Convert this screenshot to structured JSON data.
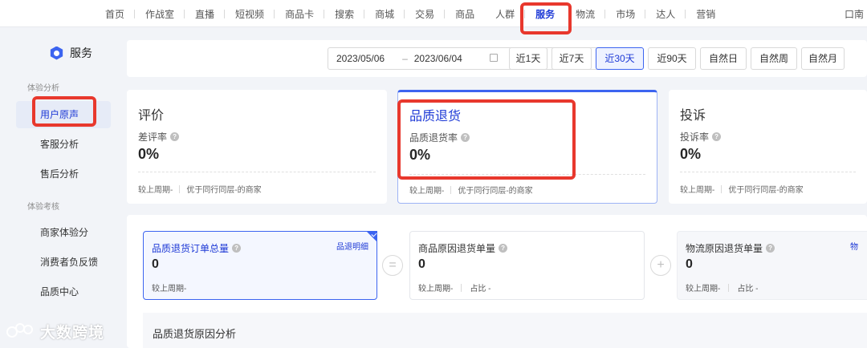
{
  "topnav": {
    "items": [
      "首页",
      "作战室",
      "直播",
      "短视频",
      "商品卡",
      "搜索",
      "商城",
      "交易",
      "商品",
      "人群",
      "服务",
      "物流",
      "市场",
      "达人",
      "营销"
    ],
    "active": "服务",
    "right_text": "口南"
  },
  "sidebar": {
    "title": "服务",
    "groups": [
      {
        "label": "体验分析",
        "items": [
          "用户原声",
          "客服分析",
          "售后分析"
        ]
      },
      {
        "label": "体验考核",
        "items": [
          "商家体验分",
          "消费者负反馈",
          "品质中心"
        ]
      }
    ],
    "active_item": "用户原声"
  },
  "datebar": {
    "start_date": "2023/05/06",
    "separator": "–",
    "end_date": "2023/06/04",
    "ranges": [
      "近1天",
      "近7天",
      "近30天",
      "近90天",
      "自然日",
      "自然周",
      "自然月"
    ],
    "active_range": "近30天"
  },
  "cards": [
    {
      "title": "评价",
      "metric": "差评率",
      "value": "0%",
      "prev": "较上周期-",
      "peer": "优于同行同层-的商家"
    },
    {
      "title": "品质退货",
      "metric": "品质退货率",
      "value": "0%",
      "prev": "较上周期-",
      "peer": "优于同行同层-的商家"
    },
    {
      "title": "投诉",
      "metric": "投诉率",
      "value": "0%",
      "prev": "较上周期-",
      "peer": "优于同行同层-的商家"
    }
  ],
  "subcards": [
    {
      "title": "品质退货订单总量",
      "value": "0",
      "prev": "较上周期-",
      "share": "",
      "link": "品退明细"
    },
    {
      "title": "商品原因退货单量",
      "value": "0",
      "prev": "较上周期-",
      "share": "占比 -",
      "link": ""
    },
    {
      "title": "物流原因退货单量",
      "value": "0",
      "prev": "较上周期-",
      "share": "占比 -",
      "link": "物"
    }
  ],
  "operators": [
    "=",
    "+"
  ],
  "analysis_title": "品质退货原因分析",
  "watermark": "大数跨境",
  "colors": {
    "accent": "#3c64f0",
    "active_text": "#1e3ad6",
    "highlight": "#e8382d"
  }
}
